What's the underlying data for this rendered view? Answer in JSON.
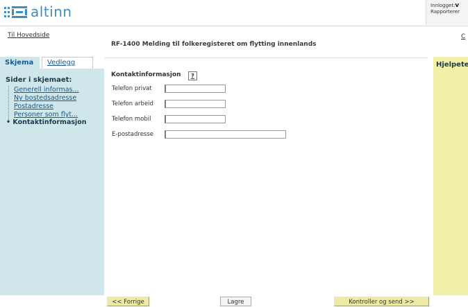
{
  "header": {
    "logo_text": "altinn",
    "user_line1_label": "Innlogget:",
    "user_line1_value": "V",
    "user_line2": "Rapporterer",
    "corner_link": "C"
  },
  "nav": {
    "home_link": "Til Hovedside"
  },
  "tabs": [
    {
      "label": "Skjema",
      "active": true
    },
    {
      "label": "Vedlegg",
      "active": false
    }
  ],
  "sidebar": {
    "title": "Sider i skjemaet:",
    "items": [
      {
        "label": "Generell informas..."
      },
      {
        "label": "Ny bostedsadresse"
      },
      {
        "label": "Postadresse"
      },
      {
        "label": "Personer som flyt..."
      },
      {
        "label": "• Kontaktinformasjon",
        "active": true
      }
    ]
  },
  "form": {
    "title": "RF-1400 Melding til folkeregisteret om flytting innenlands",
    "section_label": "Kontaktinformasjon",
    "help_icon": "?",
    "fields": [
      {
        "label": "Telefon privat",
        "value": ""
      },
      {
        "label": "Telefon arbeid",
        "value": ""
      },
      {
        "label": "Telefon mobil",
        "value": ""
      },
      {
        "label": "E-postadresse",
        "value": ""
      }
    ]
  },
  "help_panel": {
    "title": "Hjelpete"
  },
  "buttons": {
    "prev": "<< Forrige",
    "save": "Lagre",
    "send": "Kontroller og send >>"
  },
  "colors": {
    "brand": "#3b8fc4",
    "sidebar_bg": "#cfe6ea",
    "help_bg": "#f2f0a8",
    "button_bg": "#eeeaa6"
  }
}
